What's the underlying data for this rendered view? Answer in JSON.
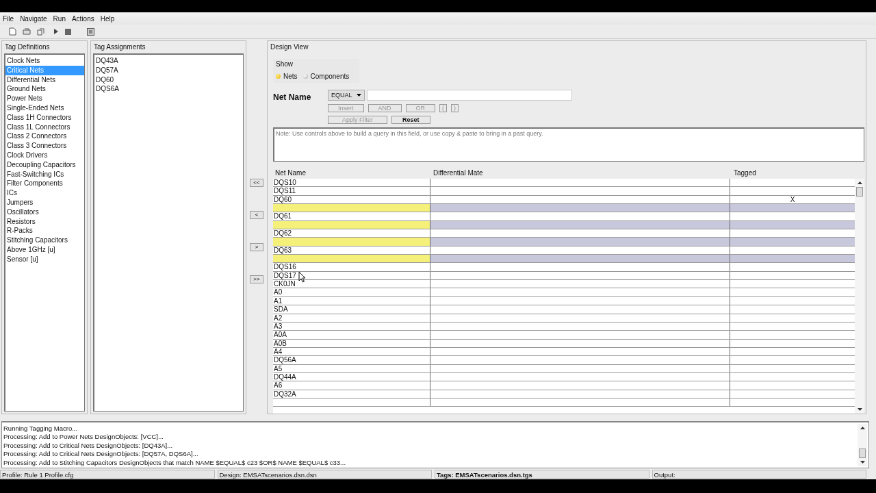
{
  "menu": [
    "File",
    "Navigate",
    "Run",
    "Actions",
    "Help"
  ],
  "tag_definitions": {
    "title": "Tag Definitions",
    "items": [
      {
        "label": "Clock Nets",
        "selected": false
      },
      {
        "label": "Critical Nets",
        "selected": true
      },
      {
        "label": "Differential Nets",
        "selected": false
      },
      {
        "label": "Ground Nets",
        "selected": false
      },
      {
        "label": "Power Nets",
        "selected": false
      },
      {
        "label": "Single-Ended Nets",
        "selected": false
      },
      {
        "label": "Class 1H Connectors",
        "selected": false
      },
      {
        "label": "Class 1L Connectors",
        "selected": false
      },
      {
        "label": "Class 2 Connectors",
        "selected": false
      },
      {
        "label": "Class 3 Connectors",
        "selected": false
      },
      {
        "label": "Clock Drivers",
        "selected": false
      },
      {
        "label": "Decoupling Capacitors",
        "selected": false
      },
      {
        "label": "Fast-Switching ICs",
        "selected": false
      },
      {
        "label": "Filter Components",
        "selected": false
      },
      {
        "label": "ICs",
        "selected": false
      },
      {
        "label": "Jumpers",
        "selected": false
      },
      {
        "label": "Oscillators",
        "selected": false
      },
      {
        "label": "Resistors",
        "selected": false
      },
      {
        "label": "R-Packs",
        "selected": false
      },
      {
        "label": "Stitching Capacitors",
        "selected": false
      },
      {
        "label": "Above 1GHz [u]",
        "selected": false
      },
      {
        "label": "Sensor [u]",
        "selected": false
      }
    ]
  },
  "tag_assignments": {
    "title": "Tag Assignments",
    "items": [
      "DQ43A",
      "DQ57A",
      "DQ60",
      "DQS6A"
    ]
  },
  "move_buttons": [
    "<<",
    "<",
    ">",
    ">>"
  ],
  "design_view": {
    "title": "Design View",
    "show": {
      "label": "Show",
      "options": [
        {
          "label": "Nets",
          "selected": true
        },
        {
          "label": "Components",
          "selected": false
        }
      ]
    },
    "net_name_label": "Net Name",
    "operator": "EQUAL",
    "query_buttons": [
      {
        "label": "Insert",
        "disabled": true
      },
      {
        "label": "AND",
        "disabled": true
      },
      {
        "label": "OR",
        "disabled": true
      },
      {
        "label": "(",
        "disabled": true
      },
      {
        "label": ")",
        "disabled": true
      }
    ],
    "action_buttons": [
      {
        "label": "Apply Filter",
        "disabled": true
      },
      {
        "label": "Reset",
        "disabled": false
      }
    ],
    "query_placeholder": "Note: Use controls above to build a query in this field, or use copy & paste to bring in a past query.",
    "table": {
      "columns": [
        "Net Name",
        "Differential Mate",
        "Tagged"
      ],
      "rows": [
        {
          "net_name": "DQS10",
          "highlighted": false
        },
        {
          "net_name": "DQS11",
          "highlighted": false
        },
        {
          "net_name": "DQ60",
          "tagged": "X",
          "highlighted": false
        },
        {
          "highlighted": true
        },
        {
          "net_name": "DQ61",
          "highlighted": false
        },
        {
          "highlighted": true
        },
        {
          "net_name": "DQ62",
          "highlighted": false
        },
        {
          "highlighted": true
        },
        {
          "net_name": "DQ63",
          "highlighted": false
        },
        {
          "highlighted": true
        },
        {
          "net_name": "DQS16",
          "highlighted": false
        },
        {
          "net_name": "DQS17",
          "highlighted": false
        },
        {
          "net_name": "CK0JN",
          "highlighted": false
        },
        {
          "net_name": "A0",
          "highlighted": false
        },
        {
          "net_name": "A1",
          "highlighted": false
        },
        {
          "net_name": "SDA",
          "highlighted": false
        },
        {
          "net_name": "A2",
          "highlighted": false
        },
        {
          "net_name": "A3",
          "highlighted": false
        },
        {
          "net_name": "A0A",
          "highlighted": false
        },
        {
          "net_name": "A0B",
          "highlighted": false
        },
        {
          "net_name": "A4",
          "highlighted": false
        },
        {
          "net_name": "DQ56A",
          "highlighted": false
        },
        {
          "net_name": "A5",
          "highlighted": false
        },
        {
          "net_name": "DQ44A",
          "highlighted": false
        },
        {
          "net_name": "A6",
          "highlighted": false
        },
        {
          "net_name": "DQ32A",
          "highlighted": false
        }
      ]
    }
  },
  "log": [
    "Running Tagging Macro...",
    "Processing: Add to Power Nets DesignObjects: [VCC]...",
    "Processing: Add to Critical Nets DesignObjects: [DQ43A]...",
    "Processing: Add to Critical Nets DesignObjects: [DQ57A, DQS6A]...",
    "Processing: Add to Stitching Capacitors DesignObjects that match NAME $EQUAL$  c23  $OR$ NAME $EQUAL$  c33..."
  ],
  "status_bar": [
    {
      "text": "Profile: Rule 1 Profile.cfg",
      "bold": false
    },
    {
      "text": "Design: EMSATscenarios.dsn.dsn",
      "bold": false
    },
    {
      "text": "Tags: EMSATscenarios.dsn.tgs",
      "bold": true
    },
    {
      "text": "Output:",
      "bold": false
    }
  ]
}
